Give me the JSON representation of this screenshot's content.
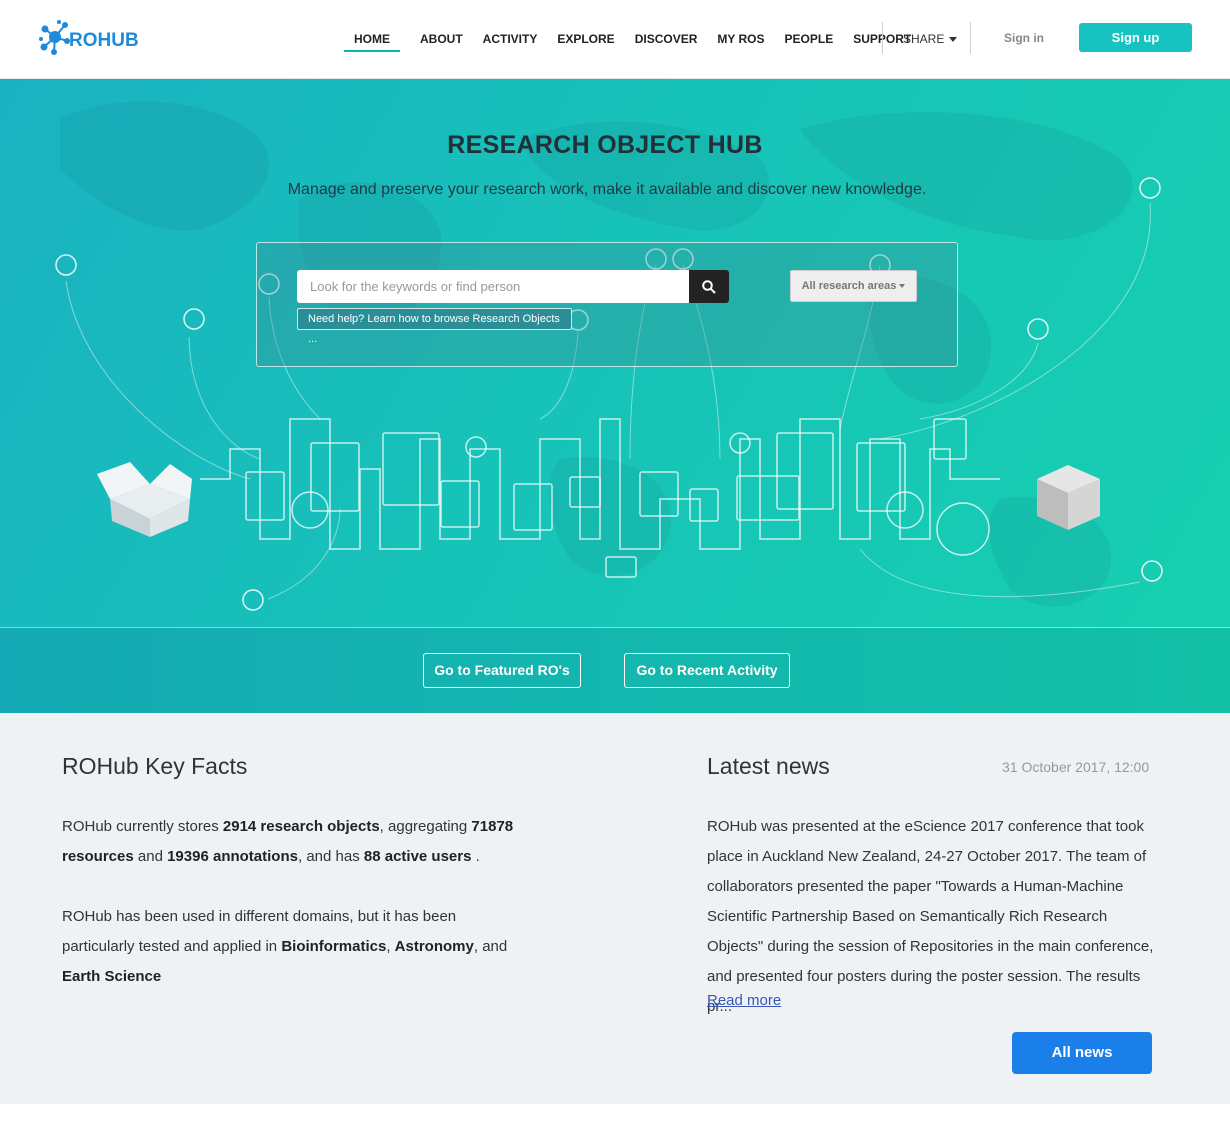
{
  "header": {
    "logo_text": "ROHUB",
    "nav": [
      {
        "label": "HOME",
        "active": true
      },
      {
        "label": "ABOUT"
      },
      {
        "label": "ACTIVITY"
      },
      {
        "label": "EXPLORE"
      },
      {
        "label": "DISCOVER"
      },
      {
        "label": "MY ROS"
      },
      {
        "label": "PEOPLE"
      },
      {
        "label": "SUPPORT"
      }
    ],
    "share_label": "SHARE",
    "signin_label": "Sign in",
    "signup_label": "Sign up"
  },
  "hero": {
    "title": "RESEARCH OBJECT HUB",
    "subtitle": "Manage and preserve your research work, make it available and discover new knowledge.",
    "search_placeholder": "Look for the keywords or find person",
    "help_link": "Need help? Learn how to browse Research Objects ...",
    "areas_label": "All research areas"
  },
  "cta": {
    "featured": "Go to Featured RO's",
    "recent": "Go to Recent Activity"
  },
  "facts": {
    "title": "ROHub Key Facts",
    "p1_a": "ROHub currently stores ",
    "research_objects": "2914 research objects",
    "p1_b": ", aggregating ",
    "resources": "71878 resources",
    "p1_c": " and ",
    "annotations": "19396 annotations",
    "p1_d": ", and has ",
    "users": "88 active users",
    "p1_e": " .",
    "p2_a": "ROHub has been used in different domains, but it has been particularly tested and applied in ",
    "d1": "Bioinformatics",
    "p2_b": ", ",
    "d2": "Astronomy",
    "p2_c": ", and ",
    "d3": "Earth Science"
  },
  "news": {
    "title": "Latest news",
    "date": "31 October 2017, 12:00",
    "body": "ROHub was presented at the eScience 2017 conference that took place in Auckland New Zealand, 24-27 October 2017. The team of collaborators presented the paper \"Towards a Human-Machine Scientific Partnership Based on Semantically Rich Research Objects\" during the session of Repositories in the main conference, and presented four posters during the poster session. The results pr...",
    "read_more": "Read more",
    "all_news": "All news"
  },
  "colors": {
    "accent": "#17c3c1",
    "primary_button": "#1a7fe8",
    "logo": "#1f8ad8"
  }
}
